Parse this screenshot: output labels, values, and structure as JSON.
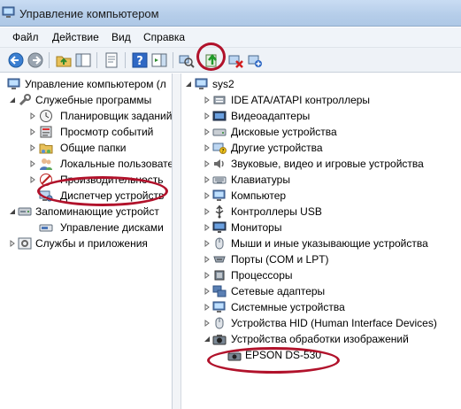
{
  "window": {
    "title": "Управление компьютером"
  },
  "menu": [
    "Файл",
    "Действие",
    "Вид",
    "Справка"
  ],
  "toolbar": {
    "buttons": [
      "back-icon",
      "forward-icon",
      "up-folder-icon",
      "show-tree-icon",
      "properties-icon",
      "help-icon",
      "action-pane-icon",
      "scan-hardware-icon",
      "update-driver-icon",
      "uninstall-icon",
      "enable-device-icon"
    ]
  },
  "left_tree": {
    "root": "Управление компьютером (л",
    "system_tools": "Служебные программы",
    "task_scheduler": "Планировщик заданий",
    "event_viewer": "Просмотр событий",
    "shared_folders": "Общие папки",
    "local_users": "Локальные пользовате",
    "performance": "Производительность",
    "device_manager": "Диспетчер устройств",
    "storage": "Запоминающие устройст",
    "disk_management": "Управление дисками",
    "services": "Службы и приложения"
  },
  "right_tree": {
    "computer": "sys2",
    "categories": [
      "IDE ATA/ATAPI контроллеры",
      "Видеоадаптеры",
      "Дисковые устройства",
      "Другие устройства",
      "Звуковые, видео и игровые устройства",
      "Клавиатуры",
      "Компьютер",
      "Контроллеры USB",
      "Мониторы",
      "Мыши и иные указывающие устройства",
      "Порты (COM и LPT)",
      "Процессоры",
      "Сетевые адаптеры",
      "Системные устройства",
      "Устройства HID (Human Interface Devices)",
      "Устройства обработки изображений"
    ],
    "imaging_device": "EPSON DS-530"
  },
  "colors": {
    "highlight_ellipse": "#b1122b",
    "title_bar": "#b5cde9"
  }
}
